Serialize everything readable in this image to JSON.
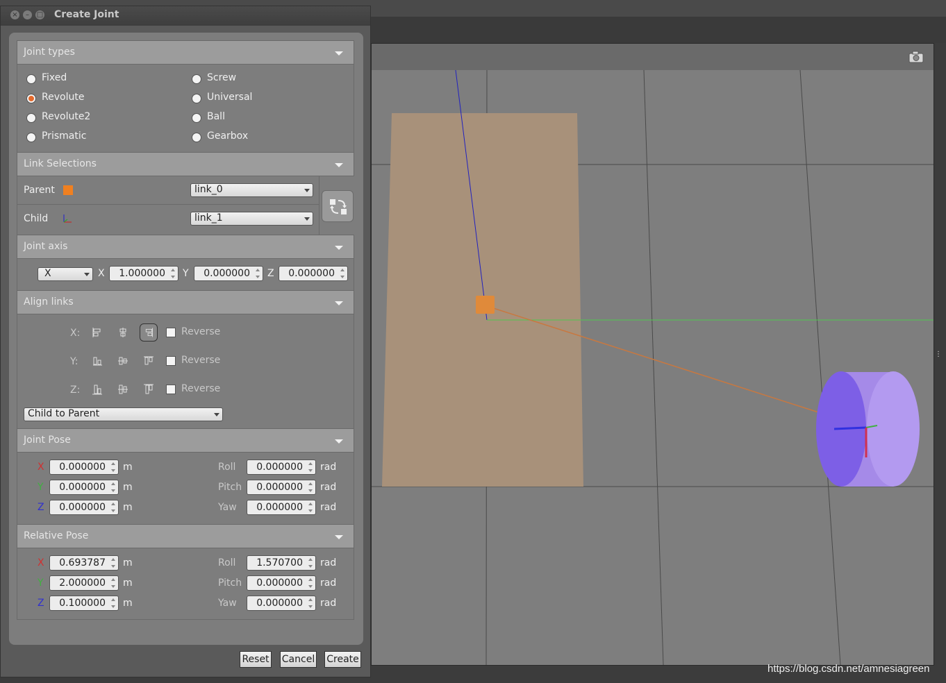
{
  "window": {
    "title": "Create Joint"
  },
  "joint_types": {
    "header": "Joint types",
    "options": [
      "Fixed",
      "Screw",
      "Revolute",
      "Universal",
      "Revolute2",
      "Ball",
      "Prismatic",
      "Gearbox"
    ],
    "selected": "Revolute"
  },
  "link_selections": {
    "header": "Link Selections",
    "parent_label": "Parent",
    "parent_value": "link_0",
    "child_label": "Child",
    "child_value": "link_1"
  },
  "joint_axis": {
    "header": "Joint axis",
    "axis_select": "X",
    "x_label": "X",
    "x_value": "1.000000",
    "y_label": "Y",
    "y_value": "0.000000",
    "z_label": "Z",
    "z_value": "0.000000"
  },
  "align_links": {
    "header": "Align links",
    "x_label": "X:",
    "y_label": "Y:",
    "z_label": "Z:",
    "reverse_label": "Reverse",
    "mode": "Child to Parent"
  },
  "joint_pose": {
    "header": "Joint Pose",
    "x_label": "X",
    "y_label": "Y",
    "z_label": "Z",
    "x": "0.000000",
    "y": "0.000000",
    "z": "0.000000",
    "roll_label": "Roll",
    "pitch_label": "Pitch",
    "yaw_label": "Yaw",
    "roll": "0.000000",
    "pitch": "0.000000",
    "yaw": "0.000000",
    "unit_m": "m",
    "unit_rad": "rad"
  },
  "relative_pose": {
    "header": "Relative Pose",
    "x_label": "X",
    "y_label": "Y",
    "z_label": "Z",
    "x": "0.693787",
    "y": "2.000000",
    "z": "0.100000",
    "roll_label": "Roll",
    "pitch_label": "Pitch",
    "yaw_label": "Yaw",
    "roll": "1.570700",
    "pitch": "0.000000",
    "yaw": "0.000000",
    "unit_m": "m",
    "unit_rad": "rad"
  },
  "buttons": {
    "reset": "Reset",
    "cancel": "Cancel",
    "create": "Create"
  },
  "watermark": "https://blog.csdn.net/amnesiagreen",
  "colors": {
    "x_axis": "#d03030",
    "y_axis": "#40b040",
    "z_axis": "#3030d0",
    "radio_checked": "#e46a2c",
    "parent_swatch": "#f08020"
  },
  "icons": [
    "close-icon",
    "minimize-icon",
    "maximize-icon",
    "dropdown-arrow-icon",
    "swap-links-icon",
    "camera-icon",
    "align-min-icon",
    "align-center-icon",
    "align-max-icon",
    "link-frame-icon"
  ]
}
